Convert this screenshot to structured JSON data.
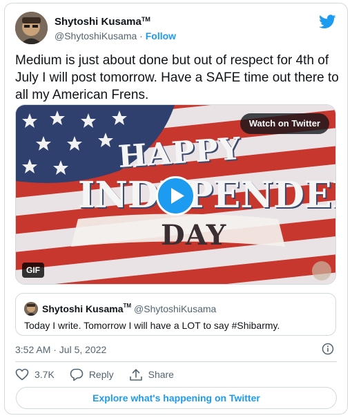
{
  "author": {
    "display_name": "Shytoshi Kusama",
    "tm": "TM",
    "handle": "@ShytoshiKusama",
    "separator": " · ",
    "follow_label": "Follow"
  },
  "tweet": {
    "text": "Medium is just about done but out of respect for 4th of July I will post tomorrow. Have a SAFE time out there to all my American Frens."
  },
  "media": {
    "watch_label": "Watch on Twitter",
    "gif_badge": "GIF",
    "headline_line1": "HAPPY",
    "headline_line2": "INDEPENDENCE",
    "headline_line3": "DAY"
  },
  "quoted_tweet": {
    "display_name": "Shytoshi Kusama",
    "tm": "TM",
    "handle": "@ShytoshiKusama",
    "text": "Today I write. Tomorrow I will have a LOT to say #Shibarmy."
  },
  "timestamp": "3:52 AM · Jul 5, 2022",
  "actions": {
    "like_count": "3.7K",
    "reply_label": "Reply",
    "share_label": "Share"
  },
  "explore_label": "Explore what's happening on Twitter",
  "colors": {
    "accent": "#1d9bf0",
    "text_primary": "#0f1419",
    "text_secondary": "#536471",
    "border": "#cfd9de",
    "flag_red": "#c8372d",
    "flag_blue": "#2f3f6e"
  },
  "icons": [
    "twitter-bird-icon",
    "play-icon",
    "info-icon",
    "heart-icon",
    "reply-icon",
    "share-icon"
  ]
}
